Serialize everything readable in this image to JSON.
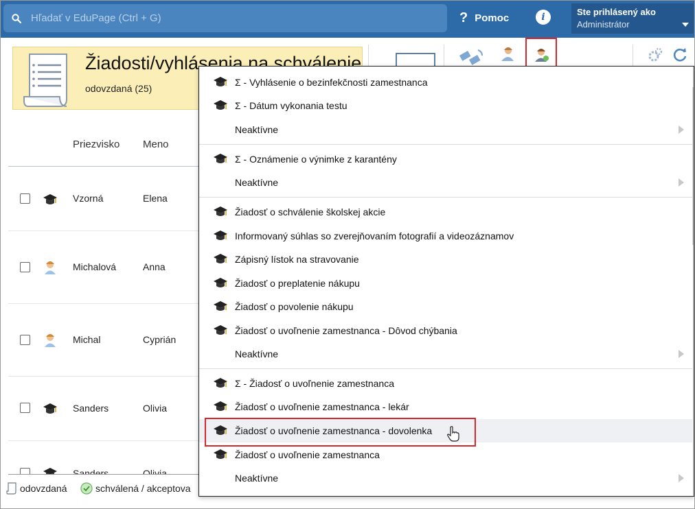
{
  "topbar": {
    "search_placeholder": "Hľadať v EduPage (Ctrl + G)",
    "help_label": "Pomoc",
    "info_icon": "i",
    "user_line1": "Ste prihlásený ako",
    "user_line2": "Administrátor"
  },
  "page": {
    "title": "Žiadosti/vyhlásenia na schválenie",
    "subtitle": "odovzdaná (25)"
  },
  "table": {
    "headers": {
      "surname": "Priezvisko",
      "name": "Meno"
    },
    "rows": [
      {
        "surname": "Vzorná",
        "name": "Elena",
        "icon": "student-cap-icon"
      },
      {
        "surname": "Michalová",
        "name": "Anna",
        "icon": "teacher-icon"
      },
      {
        "surname": "Michal",
        "name": "Cyprián",
        "icon": "teacher-icon"
      },
      {
        "surname": "Sanders",
        "name": "Olivia",
        "icon": "student-cap-icon"
      },
      {
        "surname": "Sanders",
        "name": "Olivia",
        "icon": "student-cap-icon"
      }
    ]
  },
  "legend": {
    "submitted": "odovzdaná",
    "approved": "schválená / akceptova"
  },
  "menu": {
    "items": [
      {
        "label": "Σ - Vyhlásenie o bezinfekčnosti zamestnanca",
        "icon": true
      },
      {
        "label": "Σ - Dátum vykonania testu",
        "icon": true
      },
      {
        "label": "Neaktívne",
        "icon": false,
        "submenu": true
      },
      {
        "label": "Σ - Oznámenie o výnimke z karantény",
        "icon": true
      },
      {
        "label": "Neaktívne",
        "icon": false,
        "submenu": true
      },
      {
        "label": "Žiadosť o schválenie školskej akcie",
        "icon": true
      },
      {
        "label": "Informovaný súhlas so zverejňovaním fotografií a videozáznamov",
        "icon": true
      },
      {
        "label": "Zápisný lístok na stravovanie",
        "icon": true
      },
      {
        "label": "Žiadosť o preplatenie nákupu",
        "icon": true
      },
      {
        "label": "Žiadosť o povolenie nákupu",
        "icon": true
      },
      {
        "label": "Žiadosť o uvoľnenie zamestnanca - Dôvod chýbania",
        "icon": true
      },
      {
        "label": "Neaktívne",
        "icon": false,
        "submenu": true
      },
      {
        "label": "Σ - Žiadosť o uvoľnenie zamestnanca",
        "icon": true
      },
      {
        "label": "Žiadosť o uvoľnenie zamestnanca - lekár",
        "icon": true
      },
      {
        "label": "Žiadosť o uvoľnenie zamestnanca - dovolenka",
        "icon": true,
        "hover": true
      },
      {
        "label": "Žiadosť o uvoľnenie zamestnanca",
        "icon": true
      },
      {
        "label": "Neaktívne",
        "icon": false,
        "submenu": true
      }
    ]
  },
  "colors": {
    "topbar": "#2d6aa8",
    "title_card": "#fbefb7",
    "highlight_box": "#d9262c",
    "hover_row": "#eef0f4"
  }
}
